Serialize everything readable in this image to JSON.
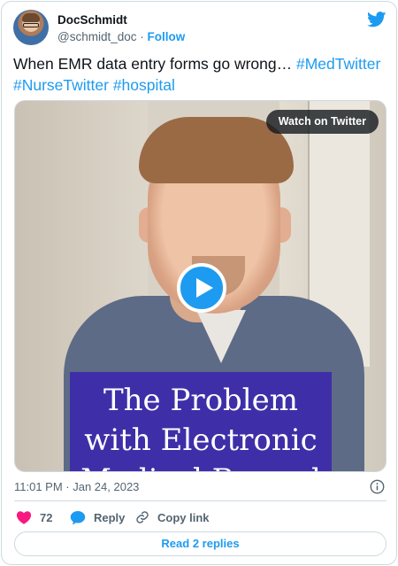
{
  "author": {
    "display_name": "DocSchmidt",
    "handle": "@schmidt_doc",
    "separator": "·",
    "follow_label": "Follow"
  },
  "tweet": {
    "text_plain": "When EMR data entry forms go wrong… ",
    "hashtags": [
      "#MedTwitter",
      "#NurseTwitter",
      "#hospital"
    ]
  },
  "media": {
    "watch_label": "Watch on Twitter",
    "overlay_lines": [
      "The Problem",
      "with Electronic",
      "Medical Record"
    ]
  },
  "meta": {
    "timestamp": "11:01 PM · Jan 24, 2023"
  },
  "actions": {
    "like_count": "72",
    "reply_label": "Reply",
    "copy_link_label": "Copy link"
  },
  "footer": {
    "read_replies_label": "Read 2 replies"
  },
  "colors": {
    "brand_blue": "#1d9bf0",
    "like_red": "#f91880",
    "text_primary": "#0f1419",
    "text_secondary": "#536471",
    "border": "#cfd9de",
    "overlay_purple": "#3e2fa8"
  },
  "icons": [
    "twitter-bird-icon",
    "play-icon",
    "info-icon",
    "heart-icon",
    "reply-bubble-icon",
    "link-icon"
  ]
}
